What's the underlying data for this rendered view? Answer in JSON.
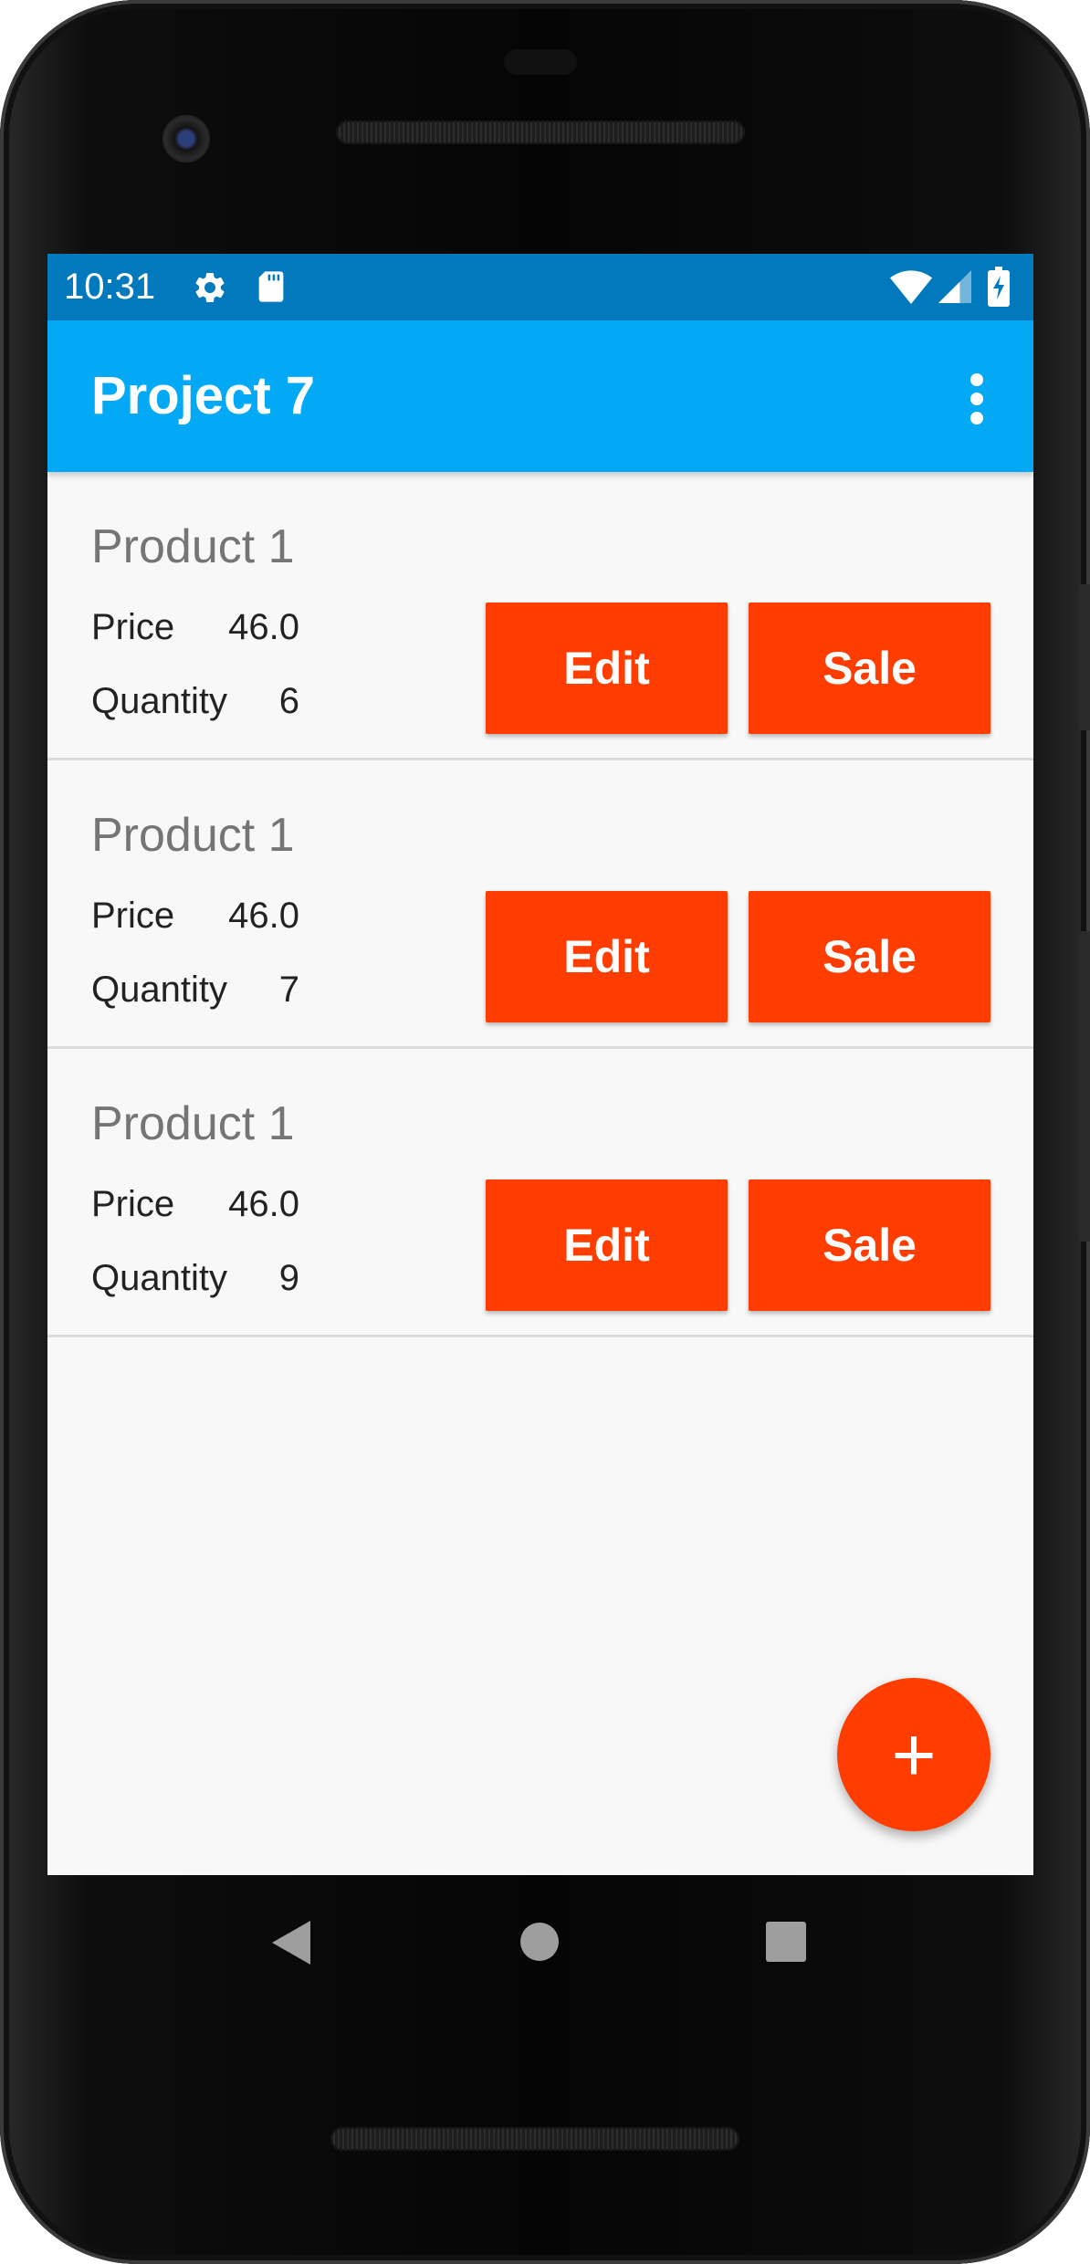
{
  "status_bar": {
    "time": "10:31",
    "left_icons": [
      "gear-icon",
      "sd-card-icon"
    ],
    "right_icons": [
      "wifi-icon",
      "cell-signal-icon",
      "battery-charging-icon"
    ],
    "color": "#0279bc"
  },
  "app_bar": {
    "title": "Project 7",
    "menu_icon": "more-vert-icon",
    "color": "#03a9f4"
  },
  "products": [
    {
      "name": "Product 1",
      "price_label": "Price",
      "price": "46.0",
      "quantity_label": "Quantity",
      "quantity": "6",
      "edit_label": "Edit",
      "sale_label": "Sale"
    },
    {
      "name": "Product 1",
      "price_label": "Price",
      "price": "46.0",
      "quantity_label": "Quantity",
      "quantity": "7",
      "edit_label": "Edit",
      "sale_label": "Sale"
    },
    {
      "name": "Product 1",
      "price_label": "Price",
      "price": "46.0",
      "quantity_label": "Quantity",
      "quantity": "9",
      "edit_label": "Edit",
      "sale_label": "Sale"
    }
  ],
  "fab": {
    "label": "+",
    "icon": "add-icon",
    "color": "#ff3d00"
  },
  "nav_bar": {
    "icons": [
      "back-icon",
      "home-icon",
      "recents-icon"
    ]
  },
  "accent_color": "#ff3d00"
}
